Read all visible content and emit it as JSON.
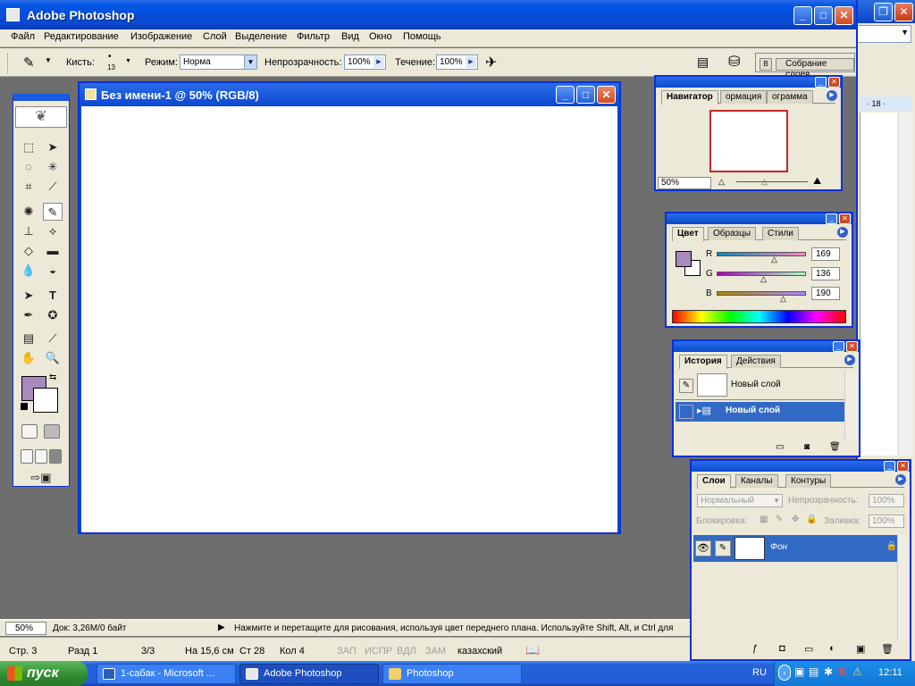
{
  "app": {
    "title": "Adobe Photoshop",
    "menus": [
      "Файл",
      "Редактирование",
      "Изображение",
      "Слой",
      "Выделение",
      "Фильтр",
      "Вид",
      "Окно",
      "Помощь"
    ]
  },
  "options_bar": {
    "brush_label": "Кисть:",
    "brush_size": "13",
    "mode_label": "Режим:",
    "mode_value": "Норма",
    "opacity_label": "Непрозрачность:",
    "opacity_value": "100%",
    "flow_label": "Течение:",
    "flow_value": "100%",
    "palette_well_label": "Собрание слоев"
  },
  "document": {
    "title": "Без имени-1 @ 50% (RGB/8)"
  },
  "navigator": {
    "tabs": [
      "Навигатор",
      "ормация",
      "ограмма"
    ],
    "zoom": "50%"
  },
  "color_palette": {
    "tabs": [
      "Цвет",
      "Образцы",
      "Стили"
    ],
    "r_label": "R",
    "r_value": "169",
    "g_label": "G",
    "g_value": "136",
    "b_label": "B",
    "b_value": "190",
    "foreground": "#a98abe",
    "background": "#ffffff"
  },
  "history": {
    "tabs": [
      "История",
      "Действия"
    ],
    "snapshot_label": "Новый слой",
    "selected_label": "Новый слой"
  },
  "layers": {
    "tabs": [
      "Слои",
      "Каналы",
      "Контуры"
    ],
    "blend_mode": "Нормальный",
    "opacity_label": "Непрозрачность:",
    "opacity_value": "100%",
    "lock_label": "Блокировка:",
    "fill_label": "Заливка:",
    "fill_value": "100%",
    "layer_name": "Фон"
  },
  "status": {
    "zoom": "50%",
    "doc_info": "Док: 3,26М/0 байт",
    "hint": "Нажмите и перетащите для рисования, используя цвет переднего плана. Используйте Shift, Alt, и Ctrl для"
  },
  "word_status": {
    "page": "Стр. 3",
    "section": "Разд 1",
    "pages": "3/3",
    "position": "На 15,6 см",
    "line": "Ст 28",
    "col": "Кол 4",
    "rec": "ЗАП",
    "trk": "ИСПР",
    "ext": "ВДЛ",
    "ovr": "ЗАМ",
    "lang": "казахский"
  },
  "word_bg": {
    "ruler_value": "18"
  },
  "taskbar": {
    "start_label": "пуск",
    "tasks": [
      "1-сабак - Microsoft ...",
      "Adobe Photoshop",
      "Photoshop"
    ],
    "lang": "RU",
    "time": "12:11"
  }
}
